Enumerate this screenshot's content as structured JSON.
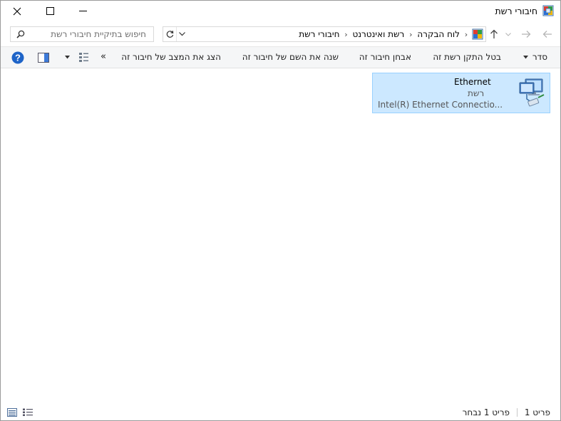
{
  "window": {
    "title": "חיבורי רשת",
    "icons": {
      "app": "network-connections-icon",
      "close": "close-icon",
      "maximize": "maximize-icon",
      "minimize": "minimize-icon"
    }
  },
  "nav": {
    "icons": {
      "back": "back-arrow-icon",
      "forward": "forward-arrow-icon",
      "recent": "chevron-down-icon",
      "up": "up-arrow-icon"
    }
  },
  "address": {
    "breadcrumbs": [
      "לוח הבקרה",
      "רשת ואינטרנט",
      "חיבורי רשת"
    ],
    "icons": {
      "location": "control-panel-icon",
      "separator": "chevron-right-icon",
      "refresh": "refresh-icon",
      "dropdown": "chevron-down-icon"
    }
  },
  "search": {
    "placeholder": "חיפוש בתיקיית חיבורי רשת",
    "icon": "search-icon"
  },
  "commands": {
    "organize": "סדר",
    "disable": "בטל התקן רשת זה",
    "diagnose": "אבחן חיבור זה",
    "rename": "שנה את השם של חיבור זה",
    "status": "הצג את המצב של חיבור זה",
    "more": "»",
    "icons": {
      "change_view": "change-view-icon",
      "preview_pane": "preview-pane-icon",
      "help": "help-icon",
      "dropdown": "chevron-down-icon"
    }
  },
  "connections": [
    {
      "name": "Ethernet",
      "type": "רשת",
      "device": "Intel(R) Ethernet Connectio...",
      "icon": "ethernet-adapter-icon",
      "selected": true
    }
  ],
  "status": {
    "item_count": "פריט 1",
    "selected_count": "פריט 1 נבחר",
    "icons": {
      "details_view": "details-view-icon",
      "large_icons_view": "large-icons-view-icon"
    }
  },
  "colors": {
    "selection_fill": "#cce8ff",
    "selection_border": "#99d1ff",
    "help_blue": "#1e64c8",
    "toolbar_bg": "#f5f6f7"
  }
}
